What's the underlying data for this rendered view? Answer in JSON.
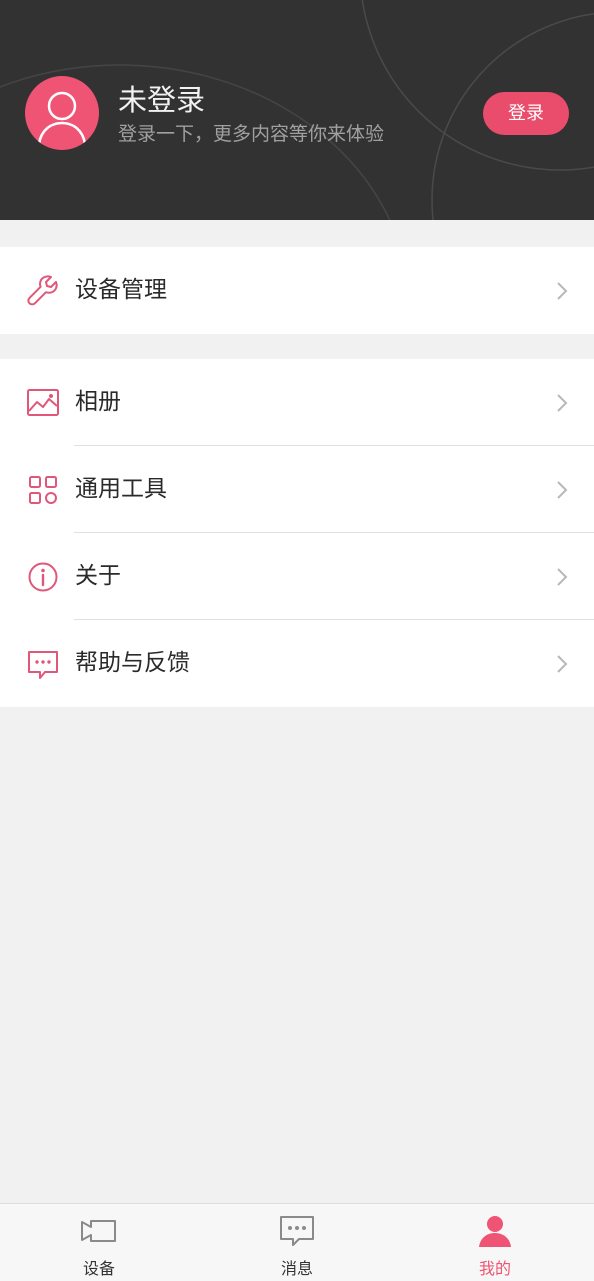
{
  "profile": {
    "name": "未登录",
    "subtitle": "登录一下，更多内容等你来体验",
    "login_button": "登录"
  },
  "menu": {
    "group1": [
      {
        "label": "设备管理",
        "icon": "wrench-icon"
      }
    ],
    "group2": [
      {
        "label": "相册",
        "icon": "picture-icon"
      },
      {
        "label": "通用工具",
        "icon": "grid-icon"
      },
      {
        "label": "关于",
        "icon": "info-icon"
      },
      {
        "label": "帮助与反馈",
        "icon": "chat-bubble-icon"
      }
    ]
  },
  "tabs": [
    {
      "label": "设备",
      "icon": "camera-icon",
      "active": false
    },
    {
      "label": "消息",
      "icon": "message-icon",
      "active": false
    },
    {
      "label": "我的",
      "icon": "person-icon",
      "active": true
    }
  ],
  "colors": {
    "accent": "#ef5474",
    "header_bg": "#323232",
    "page_bg": "#f1f1f1"
  }
}
